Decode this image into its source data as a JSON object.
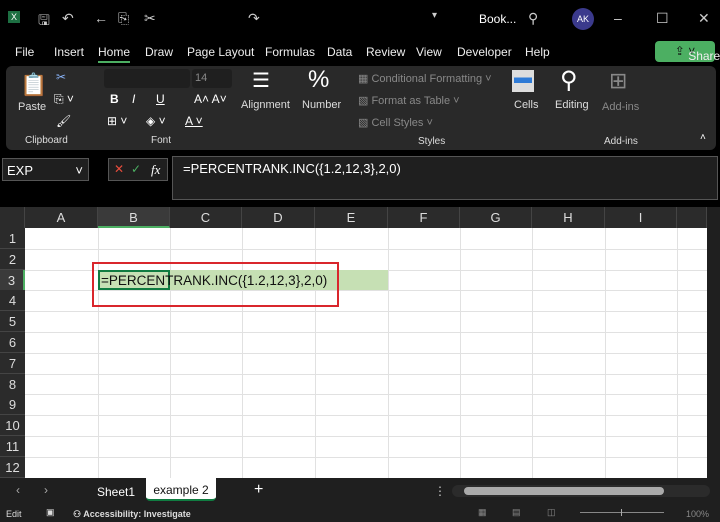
{
  "titlebar": {
    "title": "Book...",
    "user_initials": "AK"
  },
  "menu": [
    "File",
    "Insert",
    "Home",
    "Draw",
    "Page Layout",
    "Formulas",
    "Data",
    "Review",
    "View",
    "Developer",
    "Help"
  ],
  "active_menu": "Home",
  "share_label": "Share",
  "ribbon": {
    "paste": "Paste",
    "clipboard": "Clipboard",
    "font_size": "14",
    "font": "Font",
    "alignment": "Alignment",
    "number": "Number",
    "conditional_formatting": "Conditional Formatting",
    "format_as_table": "Format as Table",
    "cell_styles": "Cell Styles",
    "styles": "Styles",
    "cells": "Cells",
    "editing": "Editing",
    "addins_btn": "Add-ins",
    "addins": "Add-ins"
  },
  "formula_bar": {
    "name_box": "EXP",
    "fx": "fx",
    "formula": "=PERCENTRANK.INC({1.2,12,3},2,0)"
  },
  "columns": [
    "A",
    "B",
    "C",
    "D",
    "E",
    "F",
    "G",
    "H",
    "I"
  ],
  "rows": [
    "1",
    "2",
    "3",
    "4",
    "5",
    "6",
    "7",
    "8",
    "9",
    "10",
    "11",
    "12"
  ],
  "cell_b3": "=PERCENTRANK.INC({1.2,12,3},2,0)",
  "sheets": [
    "Sheet1",
    "example 2"
  ],
  "active_sheet": "example 2",
  "status": {
    "mode": "Edit",
    "accessibility": "Accessibility: Investigate",
    "zoom": "100%"
  },
  "colors": {
    "accent": "#107c41",
    "share": "#4caf62",
    "highlight": "#c6e0b4",
    "red_box": "#d9262c"
  }
}
